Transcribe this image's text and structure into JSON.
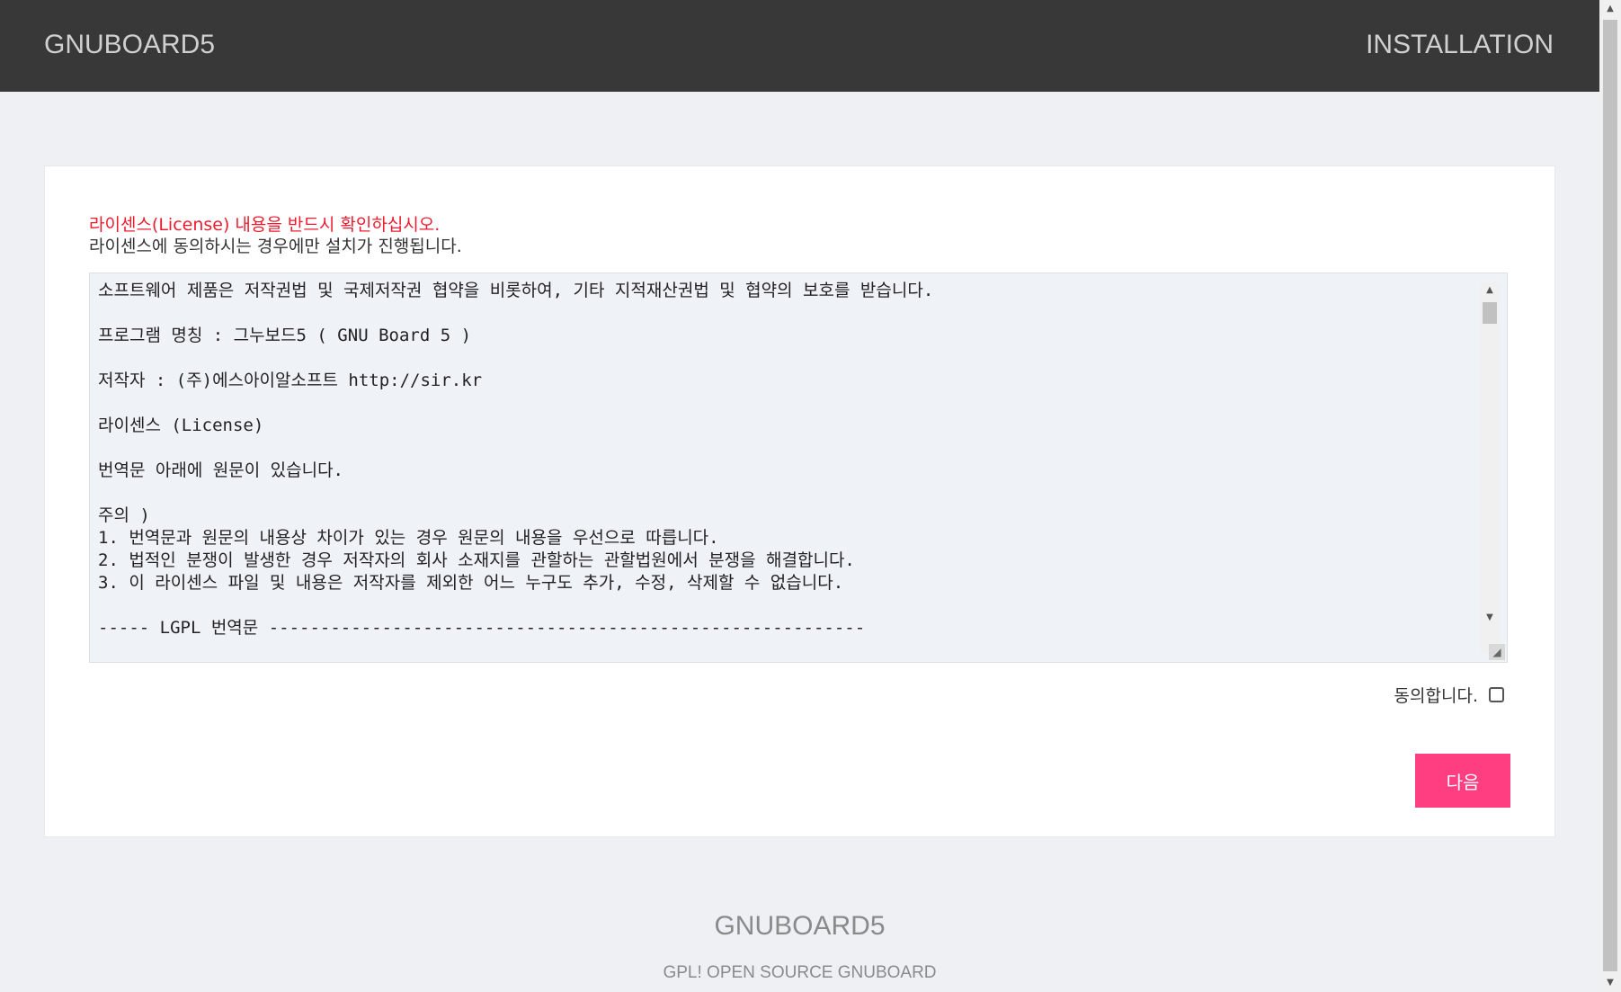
{
  "header": {
    "logo": "GNUBOARD5",
    "title": "INSTALLATION"
  },
  "panel": {
    "notice_red": "라이센스(License) 내용을 반드시 확인하십시오.",
    "notice": "라이센스에 동의하시는 경우에만 설치가 진행됩니다.",
    "license_text": "소프트웨어 제품은 저작권법 및 국제저작권 협약을 비롯하여, 기타 지적재산권법 및 협약의 보호를 받습니다.\n\n프로그램 명칭 : 그누보드5 ( GNU Board 5 )\n\n저작자 : (주)에스아이알소프트 http://sir.kr\n\n라이센스 (License)\n\n번역문 아래에 원문이 있습니다.\n\n주의 )\n1. 번역문과 원문의 내용상 차이가 있는 경우 원문의 내용을 우선으로 따릅니다.\n2. 법적인 분쟁이 발생한 경우 저작자의 회사 소재지를 관할하는 관할법원에서 분쟁을 해결합니다.\n3. 이 라이센스 파일 및 내용은 저작자를 제외한 어느 누구도 추가, 수정, 삭제할 수 없습니다.\n\n----- LGPL 번역문 ----------------------------------------------------------",
    "agree_label": "동의합니다.",
    "agree_checked": false,
    "next_label": "다음"
  },
  "footer": {
    "logo": "GNUBOARD5",
    "subtitle": "GPL! OPEN SOURCE GNUBOARD"
  },
  "colors": {
    "header_bg": "#383838",
    "accent_red": "#ee1b2e",
    "button_pink": "#ff3d81"
  }
}
